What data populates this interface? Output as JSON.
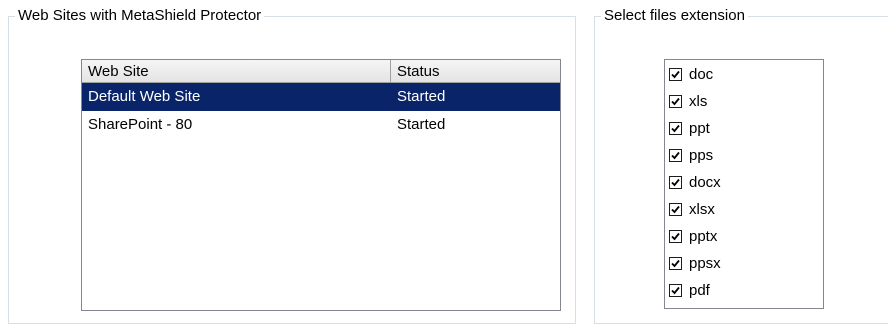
{
  "sites_group": {
    "title": "Web Sites with MetaShield Protector",
    "columns": {
      "site": "Web Site",
      "status": "Status"
    },
    "rows": [
      {
        "site": "Default Web Site",
        "status": "Started",
        "selected": true
      },
      {
        "site": "SharePoint - 80",
        "status": "Started",
        "selected": false
      }
    ]
  },
  "extensions_group": {
    "title": "Select files extension",
    "items": [
      {
        "label": "doc",
        "checked": true
      },
      {
        "label": "xls",
        "checked": true
      },
      {
        "label": "ppt",
        "checked": true
      },
      {
        "label": "pps",
        "checked": true
      },
      {
        "label": "docx",
        "checked": true
      },
      {
        "label": "xlsx",
        "checked": true
      },
      {
        "label": "pptx",
        "checked": true
      },
      {
        "label": "ppsx",
        "checked": true
      },
      {
        "label": "pdf",
        "checked": true
      }
    ]
  },
  "colors": {
    "selection": "#0a246a"
  }
}
